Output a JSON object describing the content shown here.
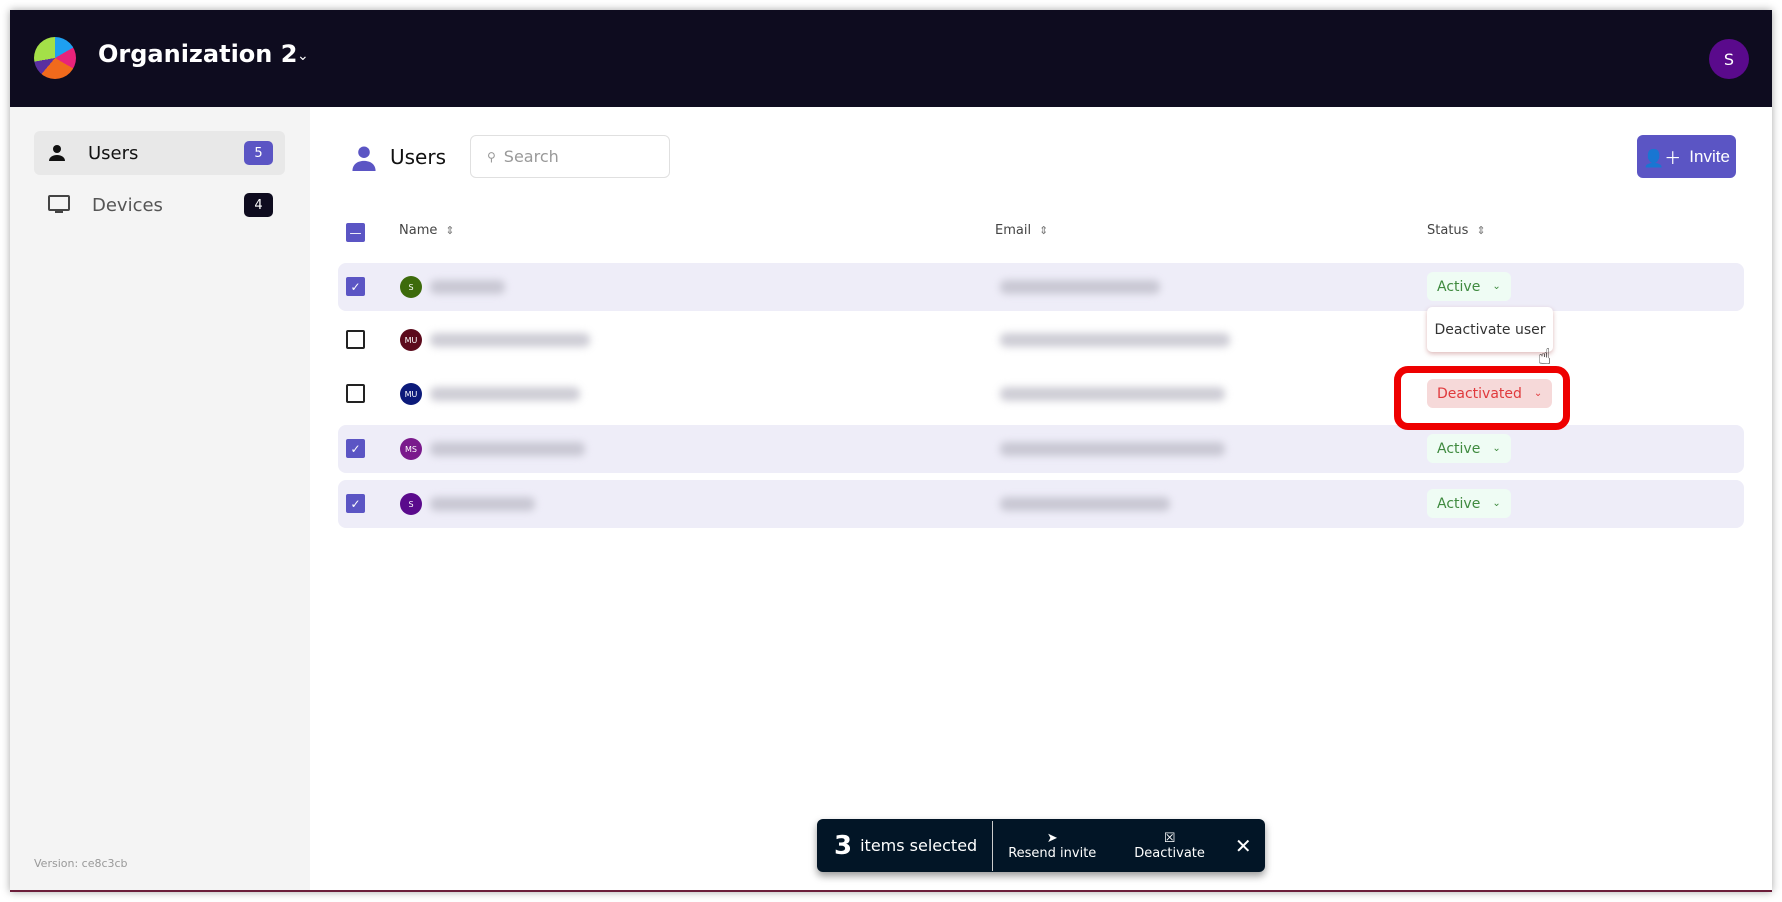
{
  "header": {
    "org_name": "Organization 2",
    "user_initial": "S"
  },
  "sidebar": {
    "items": [
      {
        "label": "Users",
        "count": "5",
        "icon": "user-icon"
      },
      {
        "label": "Devices",
        "count": "4",
        "icon": "monitor-icon"
      }
    ],
    "version": "Version: ce8c3cb"
  },
  "main": {
    "title": "Users",
    "search_placeholder": "Search",
    "invite_label": "Invite",
    "columns": [
      "Name",
      "Email",
      "Status"
    ],
    "rows": [
      {
        "initials": "S",
        "avatar_color": "#3d6b0c",
        "selected": true,
        "status": "Active"
      },
      {
        "initials": "MU",
        "avatar_color": "#5c0a1c",
        "selected": false,
        "status": ""
      },
      {
        "initials": "MU",
        "avatar_color": "#0c1a7a",
        "selected": false,
        "status": "Deactivated"
      },
      {
        "initials": "MS",
        "avatar_color": "#7a1a8c",
        "selected": true,
        "status": "Active"
      },
      {
        "initials": "S",
        "avatar_color": "#5a0a8c",
        "selected": true,
        "status": "Active"
      }
    ],
    "status_menu": {
      "item": "Deactivate user"
    }
  },
  "bulk_bar": {
    "count": "3",
    "label": "items selected",
    "resend": "Resend invite",
    "deactivate": "Deactivate"
  },
  "colors": {
    "accent": "#5b55c4",
    "header_bg": "#0e0c1f",
    "highlight": "#ee0000"
  }
}
